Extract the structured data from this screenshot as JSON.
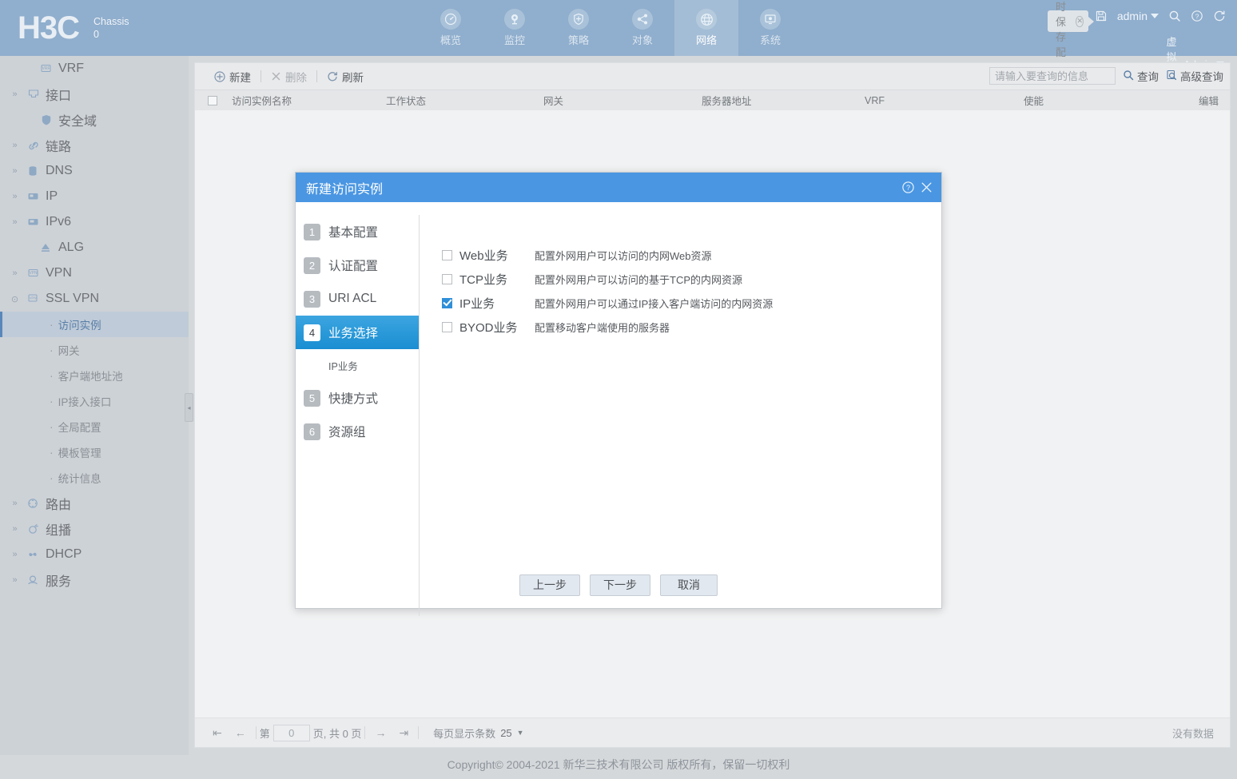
{
  "header": {
    "logo": "H3C",
    "chassis_label": "Chassis",
    "chassis_value": "0",
    "nav": [
      {
        "label": "概览",
        "icon": "gauge-icon",
        "active": false
      },
      {
        "label": "监控",
        "icon": "camera-icon",
        "active": false
      },
      {
        "label": "策略",
        "icon": "shield-plus-icon",
        "active": false
      },
      {
        "label": "对象",
        "icon": "share-nodes-icon",
        "active": false
      },
      {
        "label": "网络",
        "icon": "globe-icon",
        "active": true
      },
      {
        "label": "系统",
        "icon": "monitor-gear-icon",
        "active": false
      }
    ],
    "save_tip": "请及时保存配置",
    "admin": "admin",
    "vsys_label": "虚拟系统:",
    "vsys_value": "Admin",
    "accent": "#4a96e2"
  },
  "sidebar": {
    "items": [
      {
        "label": "VRF",
        "icon": "vrf-icon",
        "expandable": false,
        "indent": true
      },
      {
        "label": "接口",
        "icon": "interface-icon",
        "expandable": true
      },
      {
        "label": "安全域",
        "icon": "security-zone-icon",
        "expandable": false,
        "indent": true
      },
      {
        "label": "链路",
        "icon": "link-icon",
        "expandable": true
      },
      {
        "label": "DNS",
        "icon": "dns-icon",
        "expandable": true
      },
      {
        "label": "IP",
        "icon": "ip-icon",
        "expandable": true
      },
      {
        "label": "IPv6",
        "icon": "ipv6-icon",
        "expandable": true
      },
      {
        "label": "ALG",
        "icon": "alg-icon",
        "expandable": false,
        "indent": true
      },
      {
        "label": "VPN",
        "icon": "vpn-icon",
        "expandable": true
      },
      {
        "label": "SSL VPN",
        "icon": "ssl-vpn-icon",
        "expandable": true,
        "expanded": true
      }
    ],
    "sslvpn_sub": [
      {
        "label": "访问实例",
        "active": true
      },
      {
        "label": "网关",
        "active": false
      },
      {
        "label": "客户端地址池",
        "active": false
      },
      {
        "label": "IP接入接口",
        "active": false
      },
      {
        "label": "全局配置",
        "active": false
      },
      {
        "label": "模板管理",
        "active": false
      },
      {
        "label": "统计信息",
        "active": false
      }
    ],
    "items_after": [
      {
        "label": "路由",
        "icon": "route-icon",
        "expandable": true
      },
      {
        "label": "组播",
        "icon": "multicast-icon",
        "expandable": true
      },
      {
        "label": "DHCP",
        "icon": "dhcp-icon",
        "expandable": true
      },
      {
        "label": "服务",
        "icon": "service-icon",
        "expandable": true
      }
    ]
  },
  "toolbar": {
    "new_label": "新建",
    "delete_label": "删除",
    "refresh_label": "刷新",
    "search_placeholder": "请输入要查询的信息",
    "search_value": "",
    "query_label": "查询",
    "advanced_query_label": "高级查询"
  },
  "table": {
    "columns": [
      "访问实例名称",
      "工作状态",
      "网关",
      "服务器地址",
      "VRF",
      "使能",
      "编辑"
    ],
    "rows": [],
    "empty_text": "没有数据"
  },
  "pager": {
    "page_prefix": "第",
    "page_value": "0",
    "page_suffix": "页, 共 0 页",
    "size_label": "每页显示条数",
    "size_value": "25"
  },
  "footer": {
    "copyright": "Copyright© 2004-2021 新华三技术有限公司 版权所有，保留一切权利"
  },
  "modal": {
    "title": "新建访问实例",
    "steps": [
      {
        "num": "1",
        "label": "基本配置",
        "active": false
      },
      {
        "num": "2",
        "label": "认证配置",
        "active": false
      },
      {
        "num": "3",
        "label": "URI ACL",
        "active": false
      },
      {
        "num": "4",
        "label": "业务选择",
        "active": true
      }
    ],
    "sub_step": "IP业务",
    "steps_after": [
      {
        "num": "5",
        "label": "快捷方式",
        "active": false
      },
      {
        "num": "6",
        "label": "资源组",
        "active": false
      }
    ],
    "options": [
      {
        "label": "Web业务",
        "desc": "配置外网用户可以访问的内网Web资源",
        "checked": false
      },
      {
        "label": "TCP业务",
        "desc": "配置外网用户可以访问的基于TCP的内网资源",
        "checked": false
      },
      {
        "label": "IP业务",
        "desc": "配置外网用户可以通过IP接入客户端访问的内网资源",
        "checked": true
      },
      {
        "label": "BYOD业务",
        "desc": "配置移动客户端使用的服务器",
        "checked": false
      }
    ],
    "buttons": {
      "prev": "上一步",
      "next": "下一步",
      "cancel": "取消"
    }
  }
}
